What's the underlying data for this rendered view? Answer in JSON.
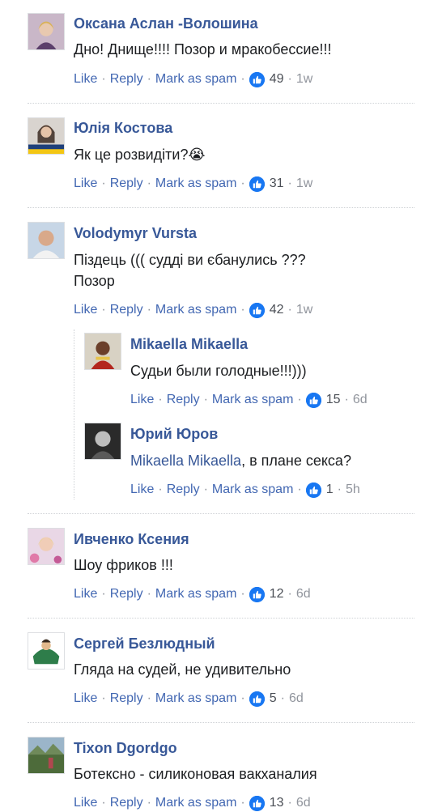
{
  "common": {
    "like": "Like",
    "reply": "Reply",
    "mark_spam": "Mark as spam",
    "sep": "·"
  },
  "comments": [
    {
      "name": "Оксана Аслан -Волошина",
      "text": [
        "Дно! Днище!!!! Позор и мракобессие!!!"
      ],
      "likes": "49",
      "time": "1w"
    },
    {
      "name": "Юлія Костова",
      "text": [
        "Як це розвидіти?😭"
      ],
      "likes": "31",
      "time": "1w"
    },
    {
      "name": "Volodymyr Vursta",
      "text": [
        "Піздець ((( судді ви єбанулись ???",
        "Позор"
      ],
      "likes": "42",
      "time": "1w"
    },
    {
      "name": "Mikaella Mikaella",
      "text": [
        "Судьи были голодные!!!)))"
      ],
      "likes": "15",
      "time": "6d"
    },
    {
      "name": "Юрий Юров",
      "mention": "Mikaella Mikaella",
      "text": [
        ", в плане секса?"
      ],
      "likes": "1",
      "time": "5h"
    },
    {
      "name": "Ивченко Ксения",
      "text": [
        "Шоу фриков !!!"
      ],
      "likes": "12",
      "time": "6d"
    },
    {
      "name": "Сергей Безлюдный",
      "text": [
        "Гляда на судей, не удивительно"
      ],
      "likes": "5",
      "time": "6d"
    },
    {
      "name": "Tixon Dgordgo",
      "text": [
        "Ботексно - силиконовая вакханалия"
      ],
      "likes": "13",
      "time": "6d"
    }
  ],
  "colors": {
    "name": "#385898",
    "link": "#4267b2",
    "like_badge": "#1877f2"
  },
  "icons": {
    "like": "thumbs-up-icon"
  }
}
